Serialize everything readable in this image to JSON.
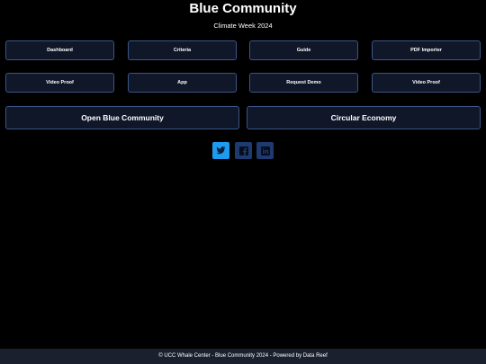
{
  "header": {
    "title": "Blue Community",
    "subtitle": "Climate Week 2024"
  },
  "nav_row1": [
    {
      "label": "Dashboard"
    },
    {
      "label": "Criteria"
    },
    {
      "label": "Guide"
    },
    {
      "label": "PDF Importer"
    }
  ],
  "nav_row2": [
    {
      "label": "Video Proof"
    },
    {
      "label": "App"
    },
    {
      "label": "Request Demo"
    },
    {
      "label": "Video Proof"
    }
  ],
  "primary_actions": [
    {
      "label": "Open Blue Community"
    },
    {
      "label": "Circular Economy"
    }
  ],
  "social": [
    {
      "icon": "twitter-icon"
    },
    {
      "icon": "facebook-icon"
    },
    {
      "icon": "linkedin-icon"
    }
  ],
  "footer": {
    "text": "© UCC Whale Center - Blue Community 2024 - Powered by Data Reef"
  },
  "colors": {
    "background": "#000000",
    "button_bg": "#0f1729",
    "button_border": "#3b5587",
    "twitter": "#1d9bf0",
    "social_dark": "#1e3a6e",
    "footer_bg": "#1a202e"
  }
}
